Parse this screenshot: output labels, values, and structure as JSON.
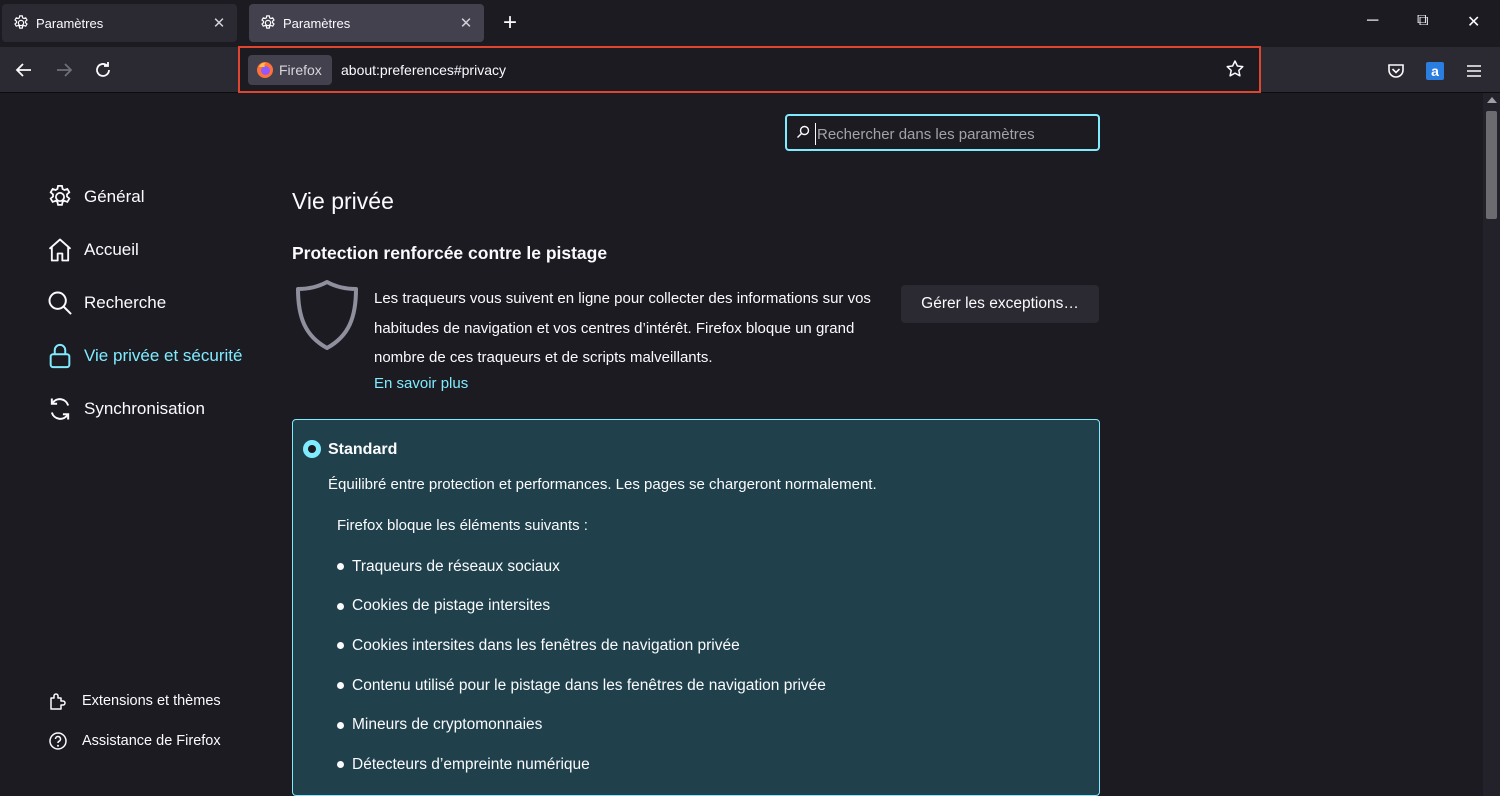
{
  "tabs": [
    {
      "title": "Paramètres",
      "icon": "gear-icon",
      "active": false
    },
    {
      "title": "Paramètres",
      "icon": "gear-icon",
      "active": true
    }
  ],
  "window_controls": {
    "minimize": "─",
    "restore": "⧉",
    "close": "✕"
  },
  "urlbar": {
    "identity_label": "Firefox",
    "url": "about:preferences#privacy",
    "highlight_color": "#e0452f"
  },
  "search": {
    "placeholder": "Rechercher dans les paramètres",
    "value": ""
  },
  "sidebar": {
    "items": [
      {
        "label": "Général",
        "icon": "gear-icon"
      },
      {
        "label": "Accueil",
        "icon": "home-icon"
      },
      {
        "label": "Recherche",
        "icon": "search-icon"
      },
      {
        "label": "Vie privée et sécurité",
        "icon": "lock-icon",
        "selected": true
      },
      {
        "label": "Synchronisation",
        "icon": "sync-icon"
      }
    ],
    "footer": [
      {
        "label": "Extensions et thèmes",
        "icon": "puzzle-icon"
      },
      {
        "label": "Assistance de Firefox",
        "icon": "help-icon"
      }
    ]
  },
  "main": {
    "page_title": "Vie privée",
    "section_title": "Protection renforcée contre le pistage",
    "description": "Les traqueurs vous suivent en ligne pour collecter des informations sur vos habitudes de navigation et vos centres d’intérêt. Firefox bloque un grand nombre de ces traqueurs et de scripts malveillants.",
    "learn_more": "En savoir plus",
    "exceptions_button": "Gérer les exceptions…",
    "standard": {
      "label": "Standard",
      "selected": true,
      "description": "Équilibré entre protection et performances. Les pages se chargeront normalement.",
      "blocks_heading": "Firefox bloque les éléments suivants :",
      "items": [
        "Traqueurs de réseaux sociaux",
        "Cookies de pistage intersites",
        "Cookies intersites dans les fenêtres de navigation privée",
        "Contenu utilisé pour le pistage dans les fenêtres de navigation privée",
        "Mineurs de cryptomonnaies",
        "Détecteurs d’empreinte numérique"
      ]
    }
  },
  "colors": {
    "accent": "#80ebff",
    "background": "#1c1b22",
    "selected_box": "#20414c"
  }
}
